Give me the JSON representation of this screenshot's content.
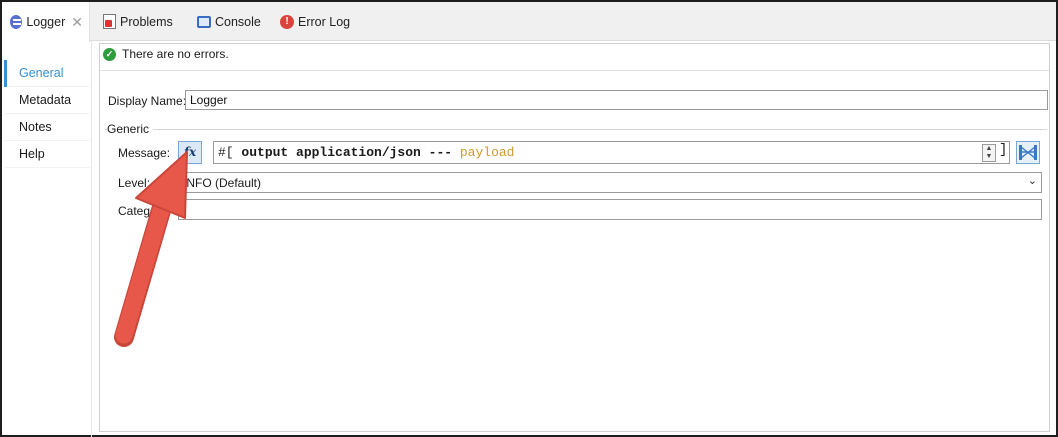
{
  "tabs": [
    {
      "label": "Logger",
      "icon": "logger-icon",
      "active": true
    },
    {
      "label": "Problems",
      "icon": "problems-icon"
    },
    {
      "label": "Console",
      "icon": "console-icon"
    },
    {
      "label": "Error Log",
      "icon": "error-log-icon"
    }
  ],
  "sidenav": {
    "items": [
      {
        "label": "General",
        "active": true
      },
      {
        "label": "Metadata"
      },
      {
        "label": "Notes"
      },
      {
        "label": "Help"
      }
    ]
  },
  "status": {
    "text": "There are no errors."
  },
  "form": {
    "display_name_label": "Display Name:",
    "display_name_value": "Logger",
    "group_label": "Generic",
    "message_label": "Message:",
    "fx_label": "fx",
    "message_prefix": "#[",
    "message_keyword": " output application/json --- ",
    "message_payload": "payload",
    "level_label": "Level:",
    "level_value": "INFO (Default)",
    "category_label": "Catego"
  },
  "colors": {
    "active_tab_accent": "#3a8fd0",
    "payload": "#d19a2d",
    "arrow": "#e8584a"
  }
}
